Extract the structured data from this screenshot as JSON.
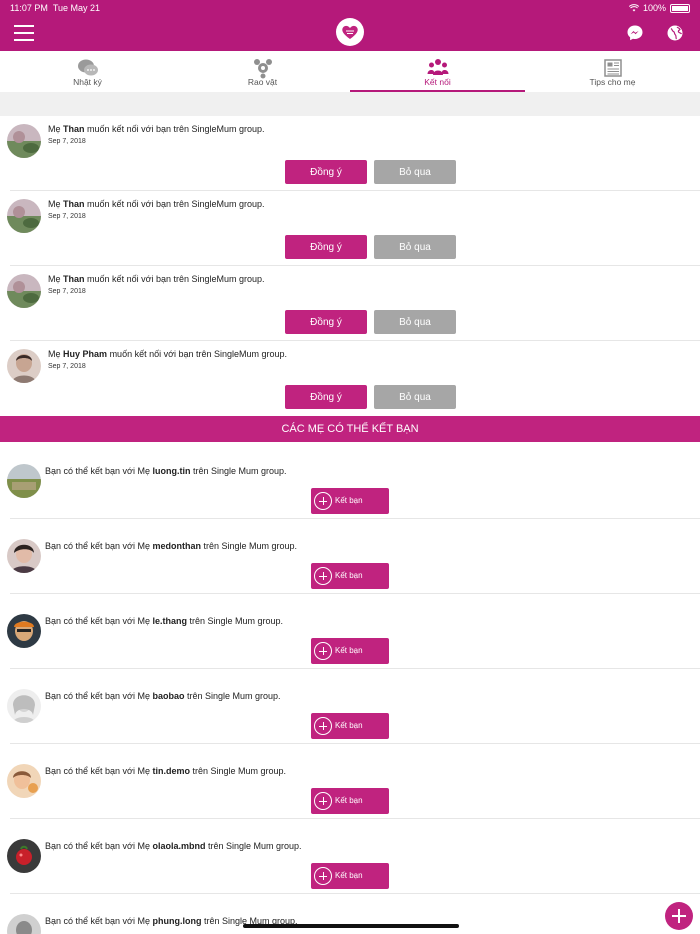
{
  "status_bar": {
    "time": "11:07 PM",
    "date": "Tue May 21",
    "battery": "100%"
  },
  "nav": {
    "menu_icon": "hamburger-icon",
    "logo_icon": "heart-logo-icon",
    "messenger_icon": "messenger-icon",
    "globe_icon": "globe-icon"
  },
  "tabs": [
    {
      "label": "Nhật ký",
      "icon": "chat-bubbles-icon"
    },
    {
      "label": "Rao vật",
      "icon": "share-nodes-icon"
    },
    {
      "label": "Kết nối",
      "icon": "group-icon"
    },
    {
      "label": "Tips cho mẹ",
      "icon": "newspaper-icon"
    }
  ],
  "requests": {
    "prefix": "Mẹ",
    "suffix": "muốn kết nối với bạn trên SingleMum group.",
    "accept_label": "Đồng ý",
    "skip_label": "Bỏ qua",
    "items": [
      {
        "name": "Than",
        "date": "Sep 7, 2018"
      },
      {
        "name": "Than",
        "date": "Sep 7, 2018"
      },
      {
        "name": "Than",
        "date": "Sep 7, 2018"
      },
      {
        "name": "Huy Pham",
        "date": "Sep 7, 2018"
      }
    ]
  },
  "suggestions": {
    "header": "CÁC MẸ CÓ THỂ KẾT BẠN",
    "prefix": "Bạn có thể kết bạn với Mẹ",
    "suffix": "trên Single Mum group.",
    "add_label": "Kết bạn",
    "items": [
      {
        "name": "luong.tin"
      },
      {
        "name": "medonthan"
      },
      {
        "name": "le.thang"
      },
      {
        "name": "baobao"
      },
      {
        "name": "tin.demo"
      },
      {
        "name": "olaola.mbnd"
      },
      {
        "name": "phung.long"
      }
    ]
  },
  "colors": {
    "primary": "#b5197a",
    "button": "#c0237f",
    "skip": "#a6a6a6"
  }
}
